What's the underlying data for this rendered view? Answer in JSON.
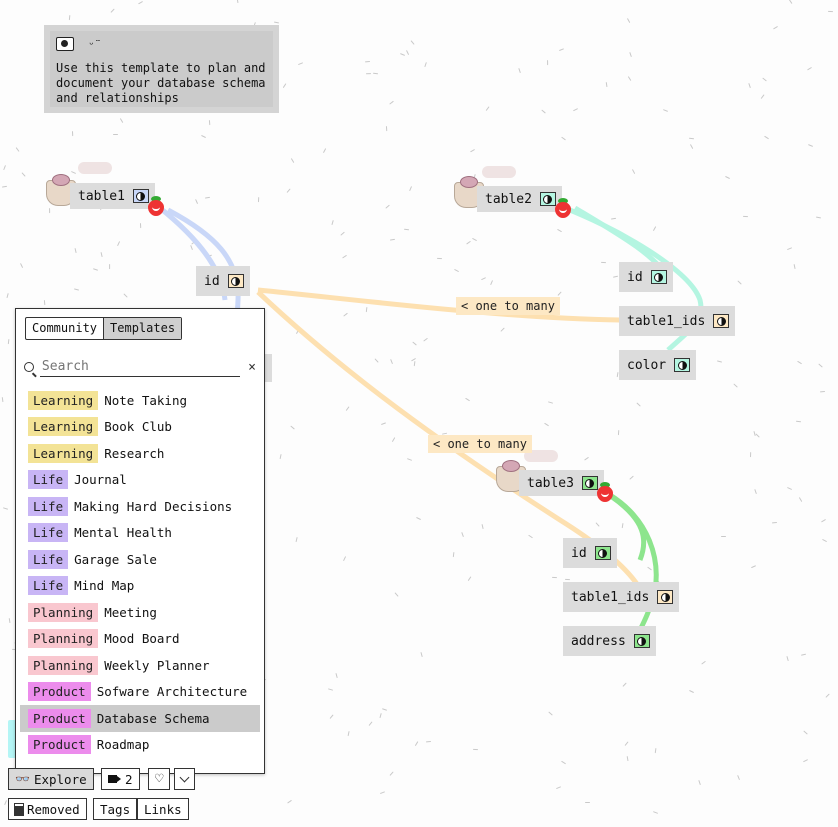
{
  "info": {
    "text": "Use this template to plan and document your database schema and relationships"
  },
  "tables": [
    {
      "name": "table1",
      "color": "#c9d7f8",
      "fields": [
        {
          "name": "id",
          "color": "#fde8c4"
        }
      ]
    },
    {
      "name": "table2",
      "color": "#b4f5e1",
      "fields": [
        {
          "name": "id",
          "color": "#b4f5e1"
        },
        {
          "name": "table1_ids",
          "color": "#fde8c4"
        },
        {
          "name": "color",
          "color": "#b4f5e1"
        }
      ]
    },
    {
      "name": "table3",
      "color": "#8de58d",
      "fields": [
        {
          "name": "id",
          "color": "#8de58d"
        },
        {
          "name": "table1_ids",
          "color": "#fde8c4"
        },
        {
          "name": "address",
          "color": "#8de58d"
        }
      ]
    }
  ],
  "relations": [
    {
      "label": "< one to many"
    },
    {
      "label": "< one to many"
    }
  ],
  "panel": {
    "tabs": [
      "Community",
      "Templates"
    ],
    "active_tab": "Templates",
    "search_placeholder": "Search",
    "clear": "×",
    "items": [
      {
        "category": "Learning",
        "name": "Note Taking",
        "color": "#f3e396"
      },
      {
        "category": "Learning",
        "name": "Book Club",
        "color": "#f3e396"
      },
      {
        "category": "Learning",
        "name": "Research",
        "color": "#f3e396"
      },
      {
        "category": "Life",
        "name": "Journal",
        "color": "#c8b5f5"
      },
      {
        "category": "Life",
        "name": "Making Hard Decisions",
        "color": "#c8b5f5"
      },
      {
        "category": "Life",
        "name": "Mental Health",
        "color": "#c8b5f5"
      },
      {
        "category": "Life",
        "name": "Garage Sale",
        "color": "#c8b5f5"
      },
      {
        "category": "Life",
        "name": "Mind Map",
        "color": "#c8b5f5"
      },
      {
        "category": "Planning",
        "name": "Meeting",
        "color": "#f9c7cf"
      },
      {
        "category": "Planning",
        "name": "Mood Board",
        "color": "#f9c7cf"
      },
      {
        "category": "Planning",
        "name": "Weekly Planner",
        "color": "#f9c7cf"
      },
      {
        "category": "Product",
        "name": "Sofware Architecture",
        "color": "#ec8cec"
      },
      {
        "category": "Product",
        "name": "Database Schema",
        "color": "#ec8cec",
        "selected": true
      },
      {
        "category": "Product",
        "name": "Roadmap",
        "color": "#ec8cec"
      }
    ]
  },
  "bottom": {
    "explore": "Explore",
    "count": "2",
    "removed": "Removed",
    "tags": "Tags",
    "links": "Links"
  },
  "icons": [
    "eye-icon",
    "smile-icon",
    "teacup-icon",
    "strawberry-icon",
    "toggle-icon",
    "search-icon",
    "trash-icon",
    "camera-icon",
    "heart-icon",
    "chevron-down-icon",
    "binoculars-icon"
  ]
}
